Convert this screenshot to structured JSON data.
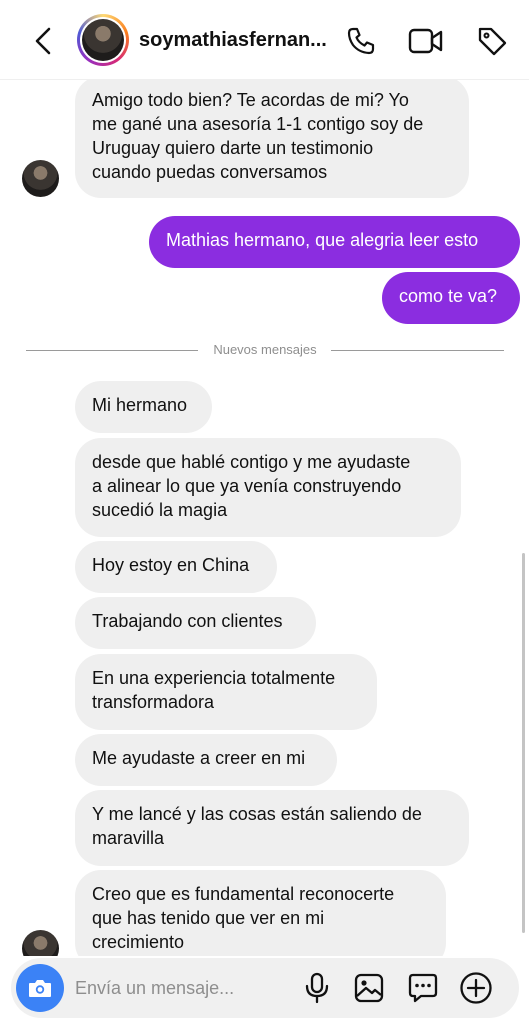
{
  "header": {
    "username": "soymathiasfernan..."
  },
  "messages": {
    "m1": [
      "Amigo todo bien? Te acordas de mi? Yo",
      "me gané una asesoría 1-1 contigo soy de",
      "Uruguay quiero darte un testimonio",
      "cuando puedas conversamos"
    ],
    "m2": "Mathias hermano, que alegria leer esto",
    "m3": "como te va?",
    "divider": "Nuevos mensajes",
    "m4": "Mi hermano",
    "m5": [
      "desde que hablé contigo y me ayudaste",
      "a alinear lo que ya venía construyendo",
      "sucedió la magia"
    ],
    "m6": "Hoy estoy en China",
    "m7": "Trabajando con clientes",
    "m8": [
      "En una experiencia totalmente",
      "transformadora"
    ],
    "m9": "Me ayudaste a creer en mi",
    "m10": [
      "Y me lancé y las cosas están saliendo de",
      "maravilla"
    ],
    "m11": [
      "Creo que es fundamental reconocerte",
      "que has tenido que ver en mi",
      "crecimiento"
    ]
  },
  "composer": {
    "placeholder": "Envía un mensaje..."
  },
  "colors": {
    "outgoing_bubble": "#8b2de0",
    "incoming_bubble": "#efefef",
    "camera_button": "#3b82f6"
  },
  "icons": [
    "chevron-left-icon",
    "phone-icon",
    "video-icon",
    "tag-icon",
    "camera-icon",
    "microphone-icon",
    "image-icon",
    "sticker-chat-icon",
    "plus-icon"
  ]
}
